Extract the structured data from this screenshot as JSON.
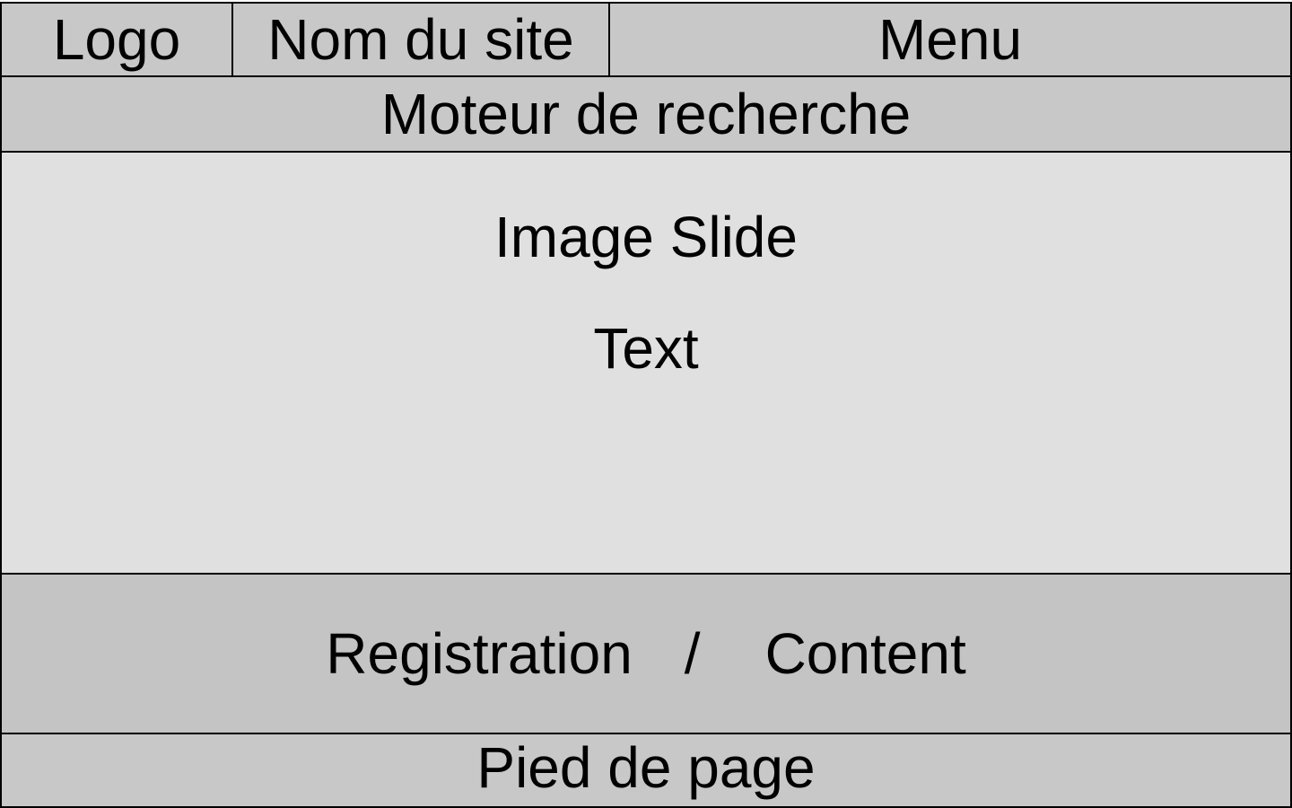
{
  "header": {
    "logo": "Logo",
    "site_name": "Nom du site",
    "menu": "Menu"
  },
  "search": {
    "label": "Moteur de recherche"
  },
  "slide": {
    "title": "Image Slide",
    "text": "Text"
  },
  "content": {
    "left": "Registration",
    "separator": "/",
    "right": "Content"
  },
  "footer": {
    "label": "Pied de page"
  },
  "colors": {
    "header_bg": "#c8c8c8",
    "slide_bg": "#e0e0e0",
    "content_bg": "#c4c4c4",
    "border": "#000000"
  }
}
